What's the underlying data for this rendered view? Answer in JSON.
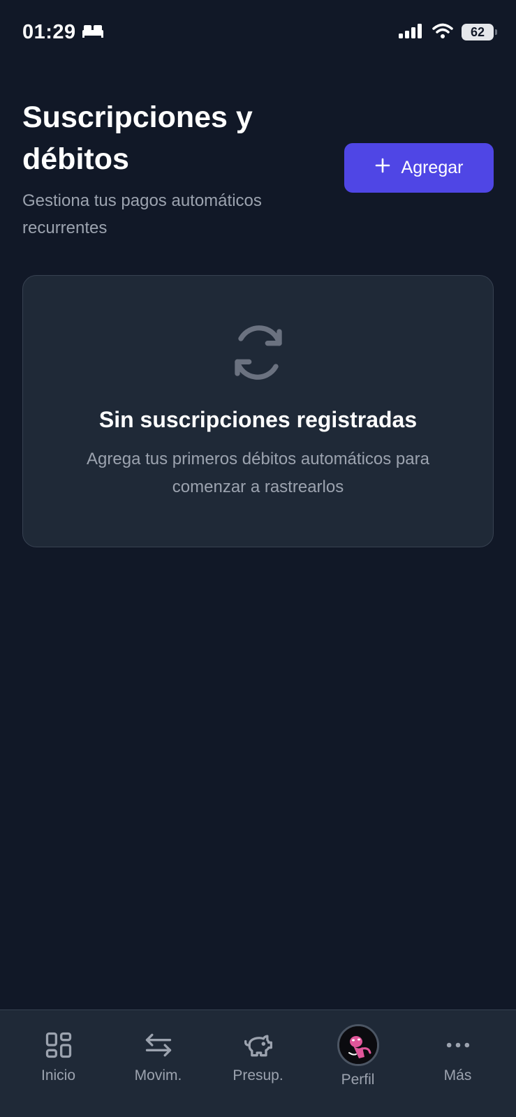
{
  "status_bar": {
    "time": "01:29",
    "battery": "62",
    "icons": [
      "bed-icon",
      "signal-icon",
      "wifi-icon",
      "battery-icon"
    ]
  },
  "header": {
    "title": "Suscripciones y débitos",
    "subtitle": "Gestiona tus pagos automáticos recurrentes",
    "add_label": "Agregar"
  },
  "empty_state": {
    "icon": "refresh-icon",
    "title": "Sin suscripciones registradas",
    "description": "Agrega tus primeros débitos automáticos para comenzar a rastrearlos"
  },
  "nav": {
    "items": [
      {
        "label": "Inicio",
        "icon": "grid-icon"
      },
      {
        "label": "Movim.",
        "icon": "transfer-arrows-icon"
      },
      {
        "label": "Presup.",
        "icon": "piggy-bank-icon"
      },
      {
        "label": "Perfil",
        "icon": "avatar"
      },
      {
        "label": "Más",
        "icon": "more-dots-icon"
      }
    ]
  },
  "colors": {
    "background": "#111827",
    "card": "#1f2937",
    "accent": "#4f46e5",
    "muted_text": "#9ca3af"
  }
}
